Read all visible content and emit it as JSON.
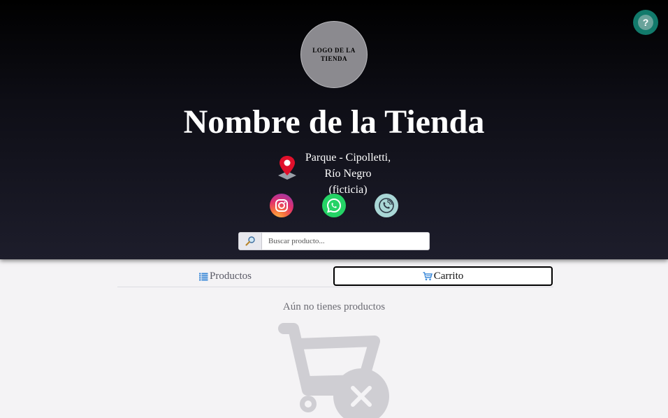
{
  "header": {
    "logo_text": "LOGO DE LA TIENDA",
    "store_name": "Nombre de la Tienda",
    "address_line1": "Parque - Cipolletti,",
    "address_line2": "Río Negro (ficticia)",
    "help_icon": "question-icon",
    "social": [
      "instagram-icon",
      "whatsapp-icon",
      "phone-icon"
    ]
  },
  "search": {
    "placeholder": "Buscar producto...",
    "icon": "search-icon"
  },
  "tabs": {
    "products_label": "Productos",
    "cart_label": "Carrito"
  },
  "cart": {
    "empty_message": "Aún no tienes productos"
  },
  "colors": {
    "help_button": "#127a6b",
    "instagram": "#e1306c",
    "whatsapp": "#25d366",
    "phone": "#a9d7d6",
    "pin": "#e0102b"
  }
}
